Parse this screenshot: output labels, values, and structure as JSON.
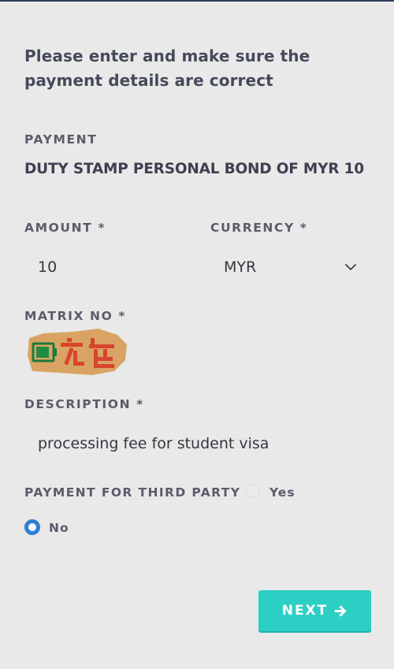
{
  "intro": {
    "line1": "Please enter and make sure the",
    "line2": "payment details are correct"
  },
  "payment": {
    "label": "PAYMENT",
    "value": "DUTY STAMP PERSONAL BOND OF MYR 10"
  },
  "amount": {
    "label": "AMOUNT *",
    "value": "10"
  },
  "currency": {
    "label": "CURRENCY *",
    "selected": "MYR",
    "icon": "chevron-down-icon"
  },
  "matrix": {
    "label": "MATRIX NO *",
    "icon": "battery-icon"
  },
  "description": {
    "label": "DESCRIPTION *",
    "value": "processing fee for student visa"
  },
  "third_party": {
    "label": "PAYMENT FOR THIRD PARTY ?",
    "options": [
      {
        "label": "Yes",
        "selected": false
      },
      {
        "label": "No",
        "selected": true
      }
    ]
  },
  "next": {
    "label": "NEXT",
    "icon": "arrow-right-icon"
  },
  "colors": {
    "background": "#e9e9e9",
    "accent": "#2ccfc4",
    "radio_selected": "#2f7fd6",
    "stamp_orange": "#d9a463",
    "stamp_red": "#d8452e",
    "battery_green": "#1e8c45"
  }
}
